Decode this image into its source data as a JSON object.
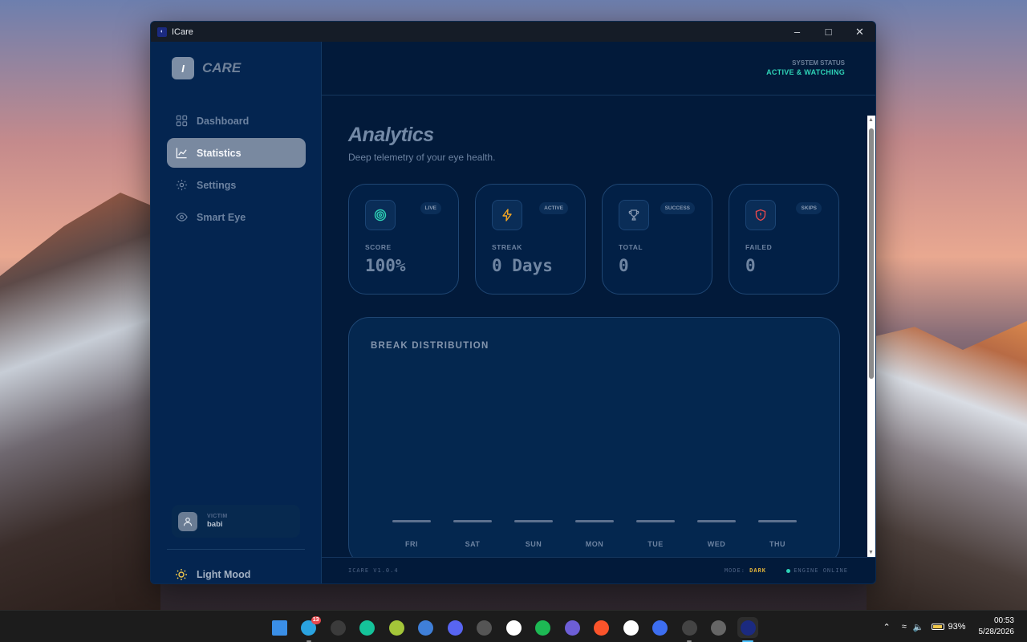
{
  "window": {
    "title": "ICare"
  },
  "sidebar": {
    "logo_mark": "I",
    "logo_text": "CARE",
    "items": [
      {
        "label": "Dashboard",
        "icon": "grid-icon",
        "active": false
      },
      {
        "label": "Statistics",
        "icon": "chart-line-icon",
        "active": true
      },
      {
        "label": "Settings",
        "icon": "gear-icon",
        "active": false
      },
      {
        "label": "Smart Eye",
        "icon": "eye-icon",
        "active": false
      }
    ],
    "user": {
      "role": "VICTIM",
      "name": "babi"
    },
    "mood_label": "Light Mood"
  },
  "header": {
    "status_label": "SYSTEM STATUS",
    "status_value": "ACTIVE & WATCHING"
  },
  "page": {
    "title": "Analytics",
    "subtitle": "Deep telemetry of your eye health."
  },
  "cards": [
    {
      "badge": "LIVE",
      "label": "SCORE",
      "value": "100%",
      "icon": "target-icon",
      "color": "#2ed3b7"
    },
    {
      "badge": "ACTIVE",
      "label": "STREAK",
      "value": "0 Days",
      "icon": "lightning-icon",
      "color": "#f5a623"
    },
    {
      "badge": "SUCCESS",
      "label": "TOTAL",
      "value": "0",
      "icon": "trophy-icon",
      "color": "#8a9bb3"
    },
    {
      "badge": "SKIPS",
      "label": "FAILED",
      "value": "0",
      "icon": "shield-alert-icon",
      "color": "#e5484d"
    }
  ],
  "chart_data": {
    "type": "bar",
    "title": "BREAK DISTRIBUTION",
    "categories": [
      "FRI",
      "SAT",
      "SUN",
      "MON",
      "TUE",
      "WED",
      "THU"
    ],
    "values": [
      0,
      0,
      0,
      0,
      0,
      0,
      0
    ]
  },
  "footer": {
    "version": "ICARE V1.0.4",
    "mode_label": "MODE:",
    "mode_value": "DARK",
    "engine": "ENGINE ONLINE"
  },
  "taskbar": {
    "apps": [
      "windows-start-icon",
      "telegram-icon",
      "obs-icon",
      "grammarly-icon",
      "apk-icon",
      "qbittorrent-icon",
      "discord-icon",
      "ball-icon",
      "notion-icon",
      "spotify-icon",
      "editor-icon",
      "brave-icon",
      "mongodb-icon",
      "app-icon",
      "zed-icon",
      "circle-app-icon",
      "icare-icon"
    ],
    "telegram_badge": "13",
    "battery": "93%",
    "time": "00:53",
    "date": "5/28/2026"
  }
}
